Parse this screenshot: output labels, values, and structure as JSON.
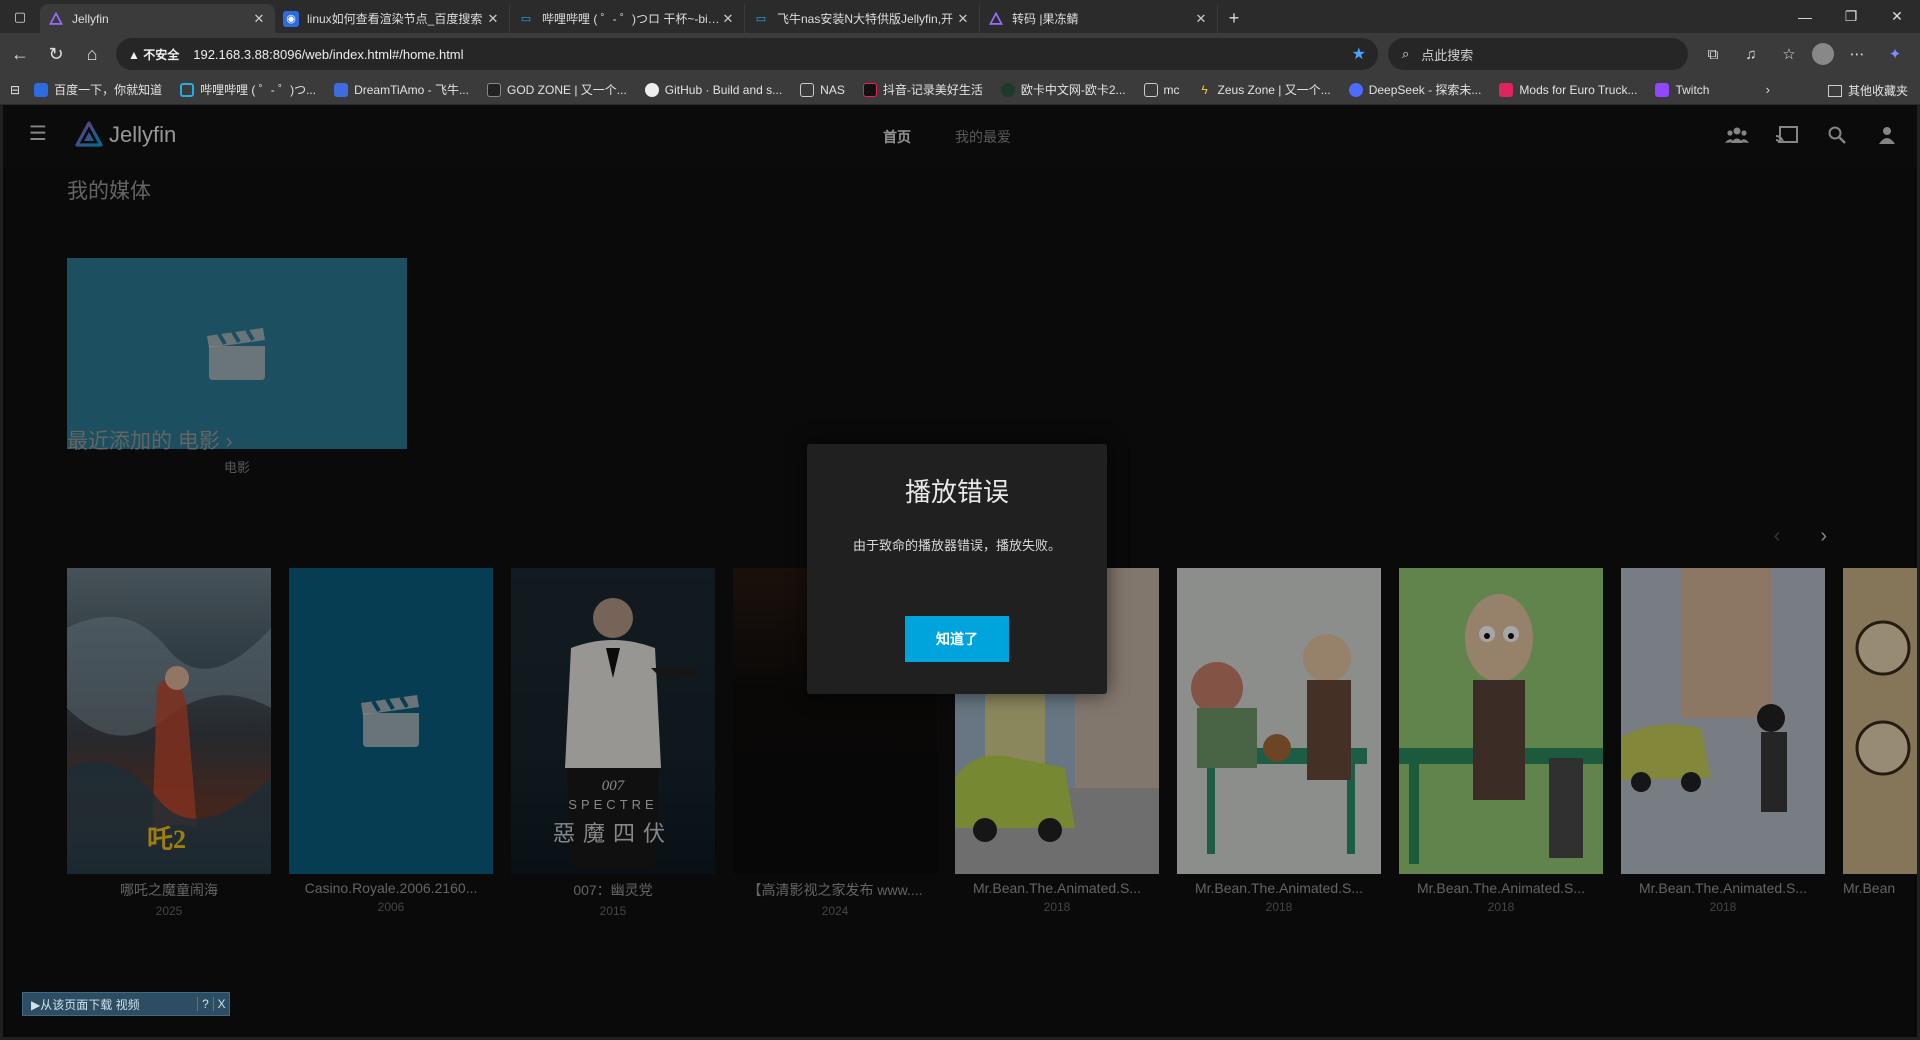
{
  "browser": {
    "tabs": [
      {
        "title": "Jellyfin",
        "active": true
      },
      {
        "title": "linux如何查看渲染节点_百度搜索",
        "active": false
      },
      {
        "title": "哔哩哔哩 ( ゜- ゜)つロ 干杯~-bilibili",
        "active": false
      },
      {
        "title": "飞牛nas安装N大特供版Jellyfin,开",
        "active": false
      },
      {
        "title": "转码 |果冻鲭",
        "active": false
      }
    ],
    "address": {
      "warning": "不安全",
      "url": "192.168.3.88:8096/web/index.html#/home.html"
    },
    "search_placeholder": "点此搜索",
    "bookmarks": [
      "百度一下，你就知道",
      "哔哩哔哩 ( ゜- ゜)つ...",
      "DreamTiAmo - 飞牛...",
      "GOD ZONE | 又一个...",
      "GitHub · Build and s...",
      "NAS",
      "抖音-记录美好生活",
      "欧卡中文网-欧卡2...",
      "mc",
      "Zeus Zone | 又一个...",
      "DeepSeek - 探索未...",
      "Mods for Euro Truck...",
      "Twitch"
    ],
    "other_bookmarks": "其他收藏夹"
  },
  "jellyfin": {
    "logo": "Jellyfin",
    "tabs": [
      {
        "label": "首页",
        "active": true
      },
      {
        "label": "我的最爱",
        "active": false
      }
    ],
    "my_media_title": "我的媒体",
    "library": {
      "label": "电影"
    },
    "recent_title": "最近添加的 电影 ›",
    "movies": [
      {
        "title": "哪吒之魔童闹海",
        "year": "2025"
      },
      {
        "title": "Casino.Royale.2006.2160...",
        "year": "2006"
      },
      {
        "title": "007：幽灵党",
        "year": "2015"
      },
      {
        "title": "【高清影视之家发布 www....",
        "year": "2024"
      },
      {
        "title": "Mr.Bean.The.Animated.S...",
        "year": "2018"
      },
      {
        "title": "Mr.Bean.The.Animated.S...",
        "year": "2018"
      },
      {
        "title": "Mr.Bean.The.Animated.S...",
        "year": "2018"
      },
      {
        "title": "Mr.Bean.The.Animated.S...",
        "year": "2018"
      },
      {
        "title": "Mr.Bean",
        "year": ""
      }
    ],
    "spectre_text": {
      "brand": "007",
      "name": "SPECTRE",
      "cn": "惡魔四伏"
    },
    "dialog": {
      "title": "播放错误",
      "message": "由于致命的播放器错误，播放失败。",
      "button": "知道了"
    }
  },
  "download_widget": {
    "label": "▶从该页面下载 视频",
    "help": "?",
    "close": "X"
  },
  "colors": {
    "accent": "#00a4dc",
    "library_card": "#2c7a94",
    "placeholder_card": "#0b5f80"
  }
}
